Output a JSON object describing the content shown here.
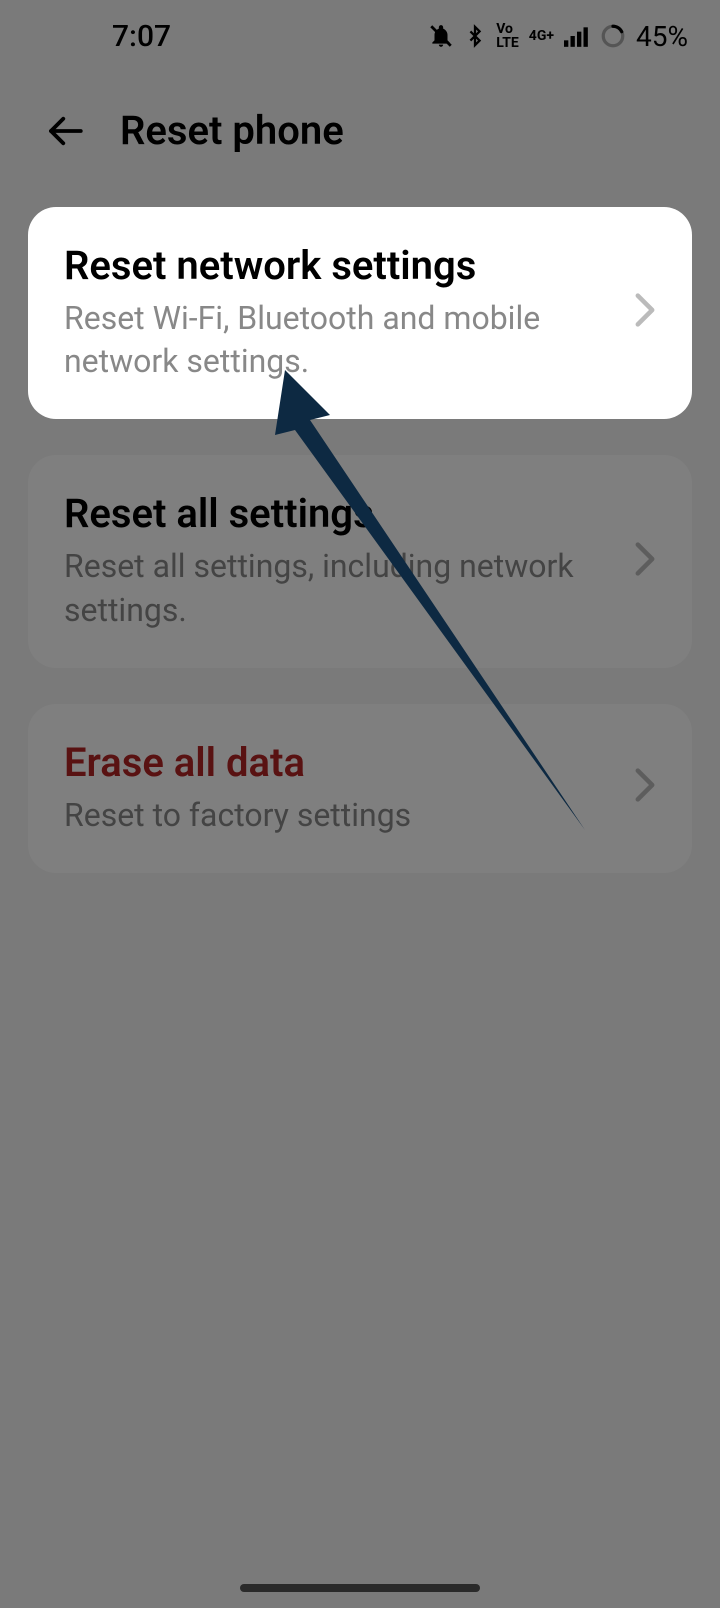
{
  "status_bar": {
    "time": "7:07",
    "battery_percent": "45%"
  },
  "header": {
    "title": "Reset phone"
  },
  "options": [
    {
      "title": "Reset network settings",
      "subtitle": "Reset Wi-Fi, Bluetooth and mobile network settings.",
      "highlighted": true
    },
    {
      "title": "Reset all settings",
      "subtitle": "Reset all settings, including network settings.",
      "highlighted": false
    },
    {
      "title": "Erase all data",
      "subtitle": "Reset to factory settings",
      "highlighted": false,
      "danger": true
    }
  ]
}
